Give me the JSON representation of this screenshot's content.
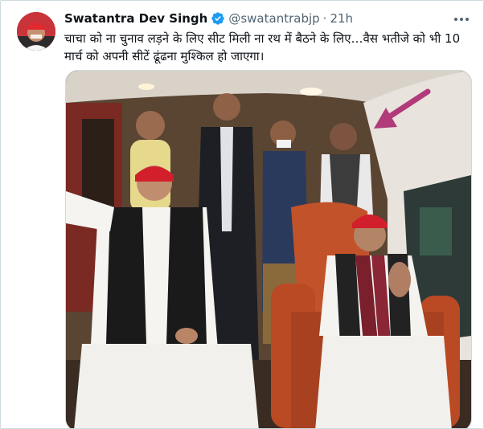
{
  "tweet": {
    "author_name": "Swatantra Dev Singh",
    "handle": "@swatantrabjp",
    "separator": "·",
    "time": "21h",
    "text": "चाचा को ना चुनाव लड़ने के लिए सीट मिली ना रथ में बैठने के लिए…वैस भतीजे को भी 10 मार्च को अपनी सीटें ढूंढना मुश्किल हो जाएगा।",
    "verified": true
  },
  "icons": {
    "verified": "verified-badge-icon",
    "more": "more-options-icon",
    "arrow": "pink-arrow-annotation"
  },
  "colors": {
    "verified_blue": "#1d9bf0",
    "secondary_text": "#536471",
    "annotation_pink": "#b03a7a",
    "red_cap": "#d11f2b"
  }
}
